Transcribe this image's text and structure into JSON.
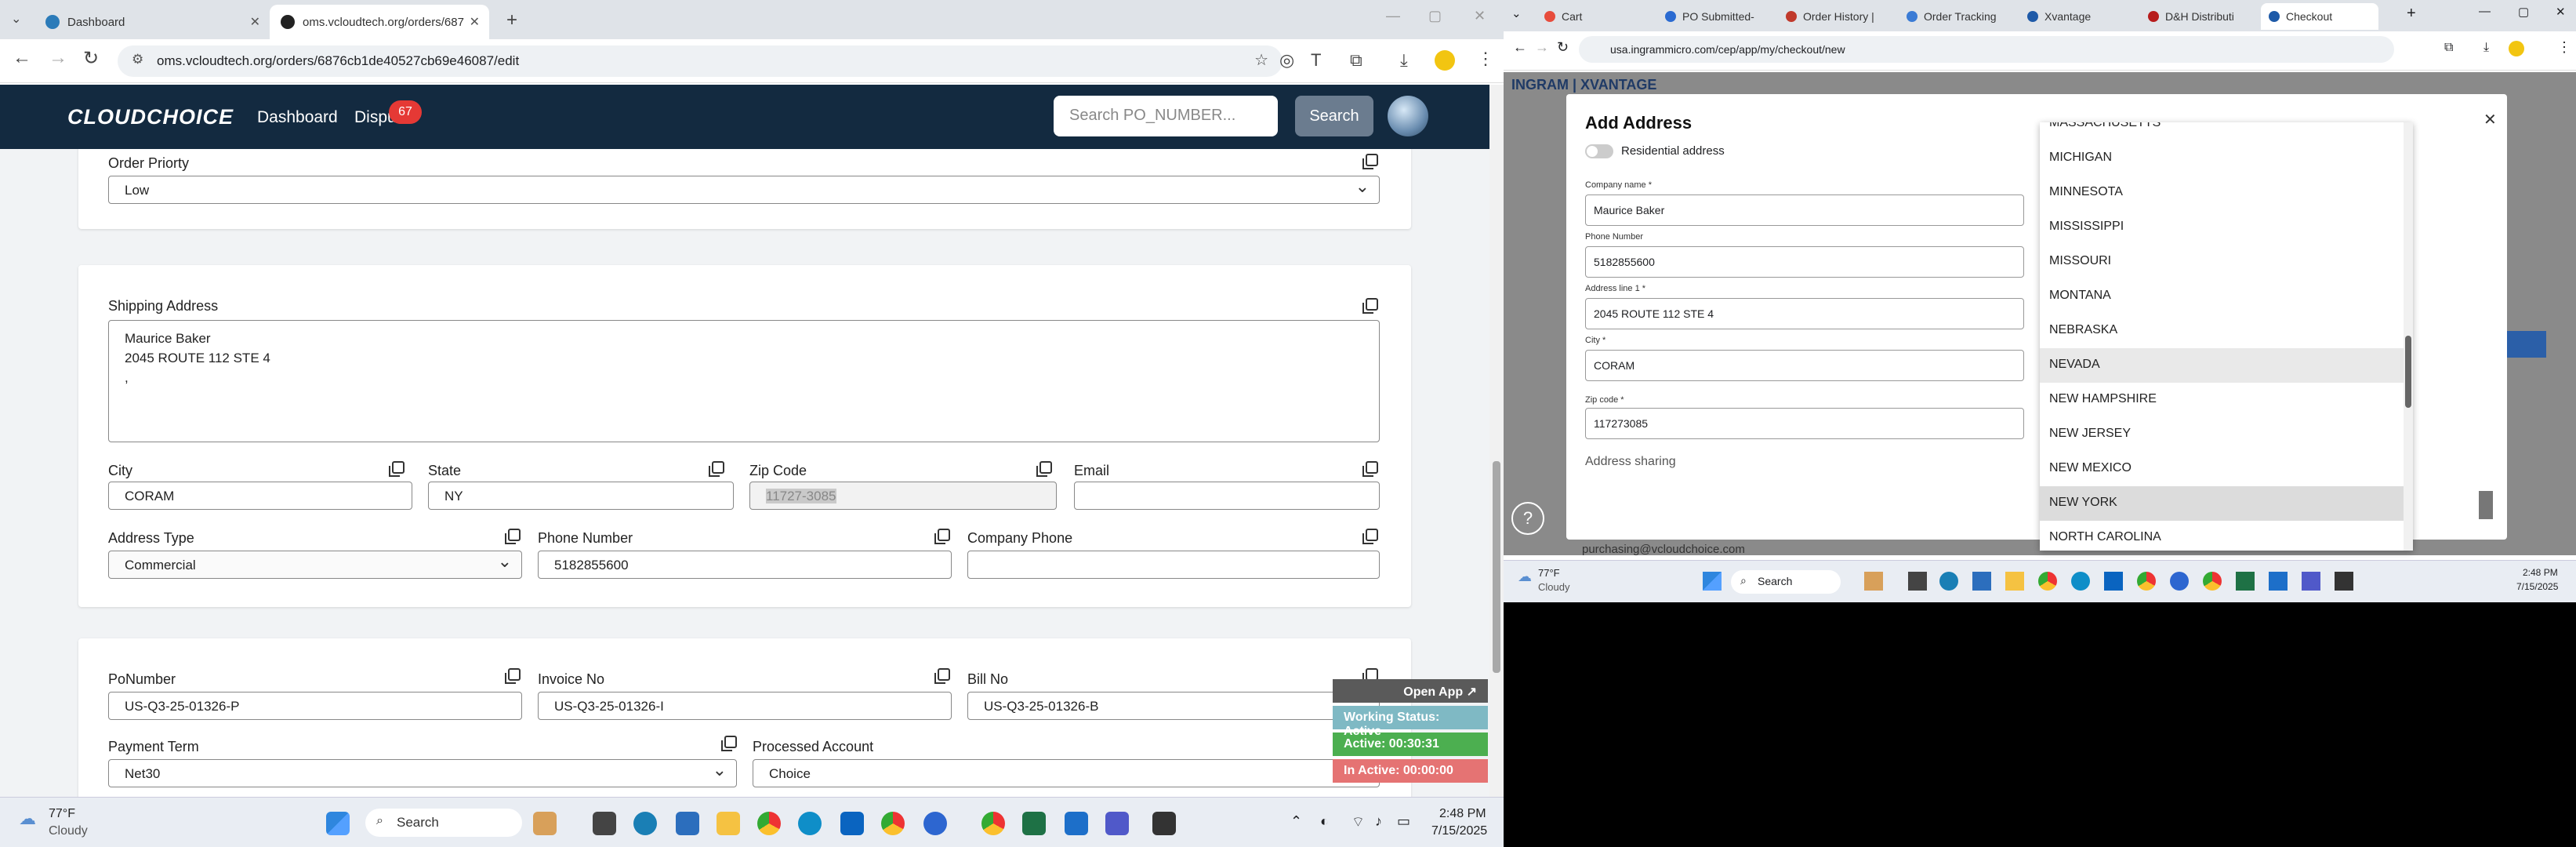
{
  "left": {
    "tabs": [
      {
        "title": "Dashboard",
        "active": false
      },
      {
        "title": "oms.vcloudtech.org/orders/687",
        "active": true
      }
    ],
    "url": "oms.vcloudtech.org/orders/6876cb1de40527cb69e46087/edit",
    "header": {
      "logo": "CLOUDCHOICE",
      "nav": [
        "Dashboard",
        "Dispu"
      ],
      "badge": "67",
      "search_placeholder": "Search PO_NUMBER...",
      "search_button": "Search"
    },
    "order_priority": {
      "label": "Order Priorty",
      "value": "Low"
    },
    "shipping": {
      "label": "Shipping Address",
      "lines": [
        "Maurice Baker",
        "2045 ROUTE 112 STE 4",
        ","
      ],
      "city": {
        "label": "City",
        "value": "CORAM"
      },
      "state": {
        "label": "State",
        "value": "NY"
      },
      "zip": {
        "label": "Zip Code",
        "value": "11727-3085"
      },
      "email": {
        "label": "Email",
        "value": ""
      },
      "address_type": {
        "label": "Address Type",
        "value": "Commercial"
      },
      "phone": {
        "label": "Phone Number",
        "value": "5182855600"
      },
      "company_phone": {
        "label": "Company Phone",
        "value": ""
      }
    },
    "po": {
      "po_number": {
        "label": "PoNumber",
        "value": "US-Q3-25-01326-P"
      },
      "invoice": {
        "label": "Invoice No",
        "value": "US-Q3-25-01326-I"
      },
      "bill": {
        "label": "Bill No",
        "value": "US-Q3-25-01326-B"
      },
      "payment_term": {
        "label": "Payment Term",
        "value": "Net30"
      },
      "processed_account": {
        "label": "Processed Account",
        "value": "Choice"
      }
    },
    "overlay": {
      "open_app": "Open App ↗",
      "working_status": "Working Status: Active",
      "active": "Active: 00:30:31",
      "inactive": "In Active: 00:00:00"
    },
    "taskbar": {
      "weather_temp": "77°F",
      "weather_desc": "Cloudy",
      "search": "Search",
      "time": "2:48 PM",
      "date": "7/15/2025"
    }
  },
  "right": {
    "tabs": [
      "Cart",
      "PO Submitted-",
      "Order History |",
      "Order Tracking",
      "Xvantage",
      "D&H Distributi",
      "Checkout"
    ],
    "url": "usa.ingrammicro.com/cep/app/my/checkout/new",
    "bg_brand": "INGRAM | XVANTAGE",
    "modal": {
      "title": "Add Address",
      "residential": "Residential address",
      "company_label": "Company name *",
      "company": "Maurice Baker",
      "phone_label": "Phone Number",
      "phone": "5182855600",
      "address_label": "Address line 1 *",
      "address": "2045 ROUTE 112 STE 4",
      "city_label": "City *",
      "city": "CORAM",
      "zip_label": "Zip code *",
      "zip": "117273085",
      "sharing": "Address sharing",
      "footer_email": "purchasing@vcloudchoice.com"
    },
    "states": [
      "MASSACHUSETTS",
      "MICHIGAN",
      "MINNESOTA",
      "MISSISSIPPI",
      "MISSOURI",
      "MONTANA",
      "NEBRASKA",
      "NEVADA",
      "NEW HAMPSHIRE",
      "NEW JERSEY",
      "NEW MEXICO",
      "NEW YORK",
      "NORTH CAROLINA"
    ],
    "taskbar": {
      "weather_temp": "77°F",
      "weather_desc": "Cloudy",
      "search": "Search",
      "time": "2:48 PM",
      "date": "7/15/2025"
    }
  }
}
